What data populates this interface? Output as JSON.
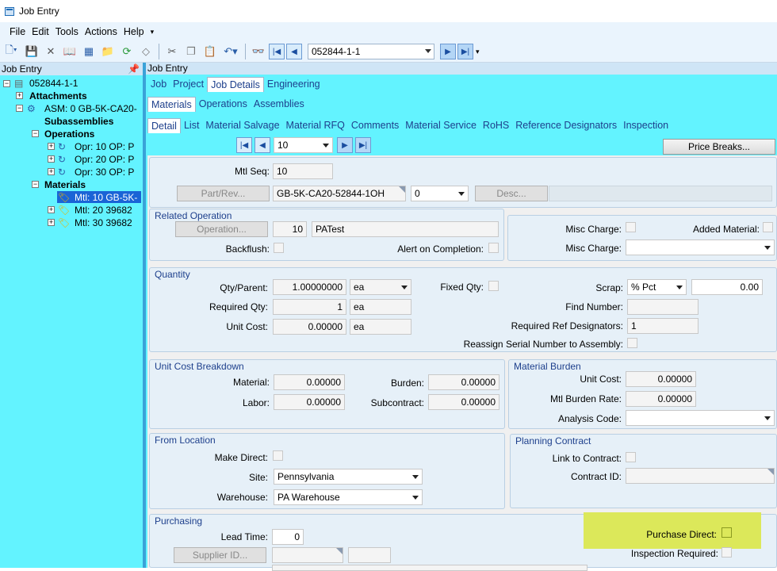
{
  "window": {
    "title": "Job Entry"
  },
  "menu": [
    "File",
    "Edit",
    "Tools",
    "Actions",
    "Help"
  ],
  "toolbar": {
    "job_value": "052844-1-1"
  },
  "tree": {
    "panel_title": "Job Entry",
    "root": "052844-1-1",
    "attachments": "Attachments",
    "asm": "ASM: 0 GB-5K-CA20-",
    "subassemblies": "Subassemblies",
    "operations": "Operations",
    "ops": [
      "Opr: 10 OP: P",
      "Opr: 20 OP: P",
      "Opr: 30 OP: P"
    ],
    "materials": "Materials",
    "mtls": [
      "Mtl: 10 GB-5K-",
      "Mtl: 20 39682",
      "Mtl: 30 39682"
    ]
  },
  "main": {
    "panel_title": "Job Entry",
    "tabs1": [
      "Job",
      "Project",
      "Job Details",
      "Engineering"
    ],
    "tabs2": [
      "Materials",
      "Operations",
      "Assemblies"
    ],
    "tabs3": [
      "Detail",
      "List",
      "Material Salvage",
      "Material RFQ",
      "Comments",
      "Material Service",
      "RoHS",
      "Reference Designators",
      "Inspection"
    ],
    "nav_value": "10",
    "price_breaks": "Price Breaks..."
  },
  "form": {
    "mtl_seq_label": "Mtl Seq:",
    "mtl_seq": "10",
    "part_rev_btn": "Part/Rev...",
    "part": "GB-5K-CA20-52844-1OH",
    "rev": "0",
    "desc_btn": "Desc...",
    "related_op": {
      "title": "Related Operation",
      "op_btn": "Operation...",
      "op_num": "10",
      "op_desc": "PATest",
      "backflush": "Backflush:",
      "alert": "Alert on Completion:"
    },
    "misc": {
      "misc_charge1": "Misc Charge:",
      "added_material": "Added Material:",
      "misc_charge2": "Misc Charge:"
    },
    "quantity": {
      "title": "Quantity",
      "qty_parent_label": "Qty/Parent:",
      "qty_parent": "1.00000000",
      "qty_uom": "ea",
      "fixed_qty": "Fixed Qty:",
      "scrap_label": "Scrap:",
      "scrap_type": "% Pct",
      "scrap_val": "0.00",
      "req_qty_label": "Required Qty:",
      "req_qty": "1",
      "req_uom": "ea",
      "find_number": "Find Number:",
      "unit_cost_label": "Unit Cost:",
      "unit_cost": "0.00000",
      "unit_uom": "ea",
      "req_ref_label": "Required Ref Designators:",
      "req_ref": "1",
      "reassign": "Reassign Serial Number to Assembly:"
    },
    "ucb": {
      "title": "Unit Cost Breakdown",
      "material_label": "Material:",
      "material": "0.00000",
      "burden_label": "Burden:",
      "burden": "0.00000",
      "labor_label": "Labor:",
      "labor": "0.00000",
      "subcontract_label": "Subcontract:",
      "subcontract": "0.00000"
    },
    "mb": {
      "title": "Material Burden",
      "unit_cost_label": "Unit Cost:",
      "unit_cost": "0.00000",
      "rate_label": "Mtl  Burden Rate:",
      "rate": "0.00000",
      "analysis_label": "Analysis Code:"
    },
    "from": {
      "title": "From Location",
      "make_direct": "Make Direct:",
      "site_label": "Site:",
      "site": "Pennsylvania",
      "wh_label": "Warehouse:",
      "wh": "PA Warehouse"
    },
    "plan": {
      "title": "Planning Contract",
      "link": "Link to Contract:",
      "contract_id": "Contract ID:"
    },
    "purch": {
      "title": "Purchasing",
      "lead_label": "Lead Time:",
      "lead": "0",
      "supplier_btn": "Supplier ID...",
      "purchase_direct": "Purchase Direct:",
      "inspection": "Inspection  Required:"
    }
  },
  "colors": {
    "panel_bg": "#63f3ff",
    "highlight": "#dce85a"
  }
}
